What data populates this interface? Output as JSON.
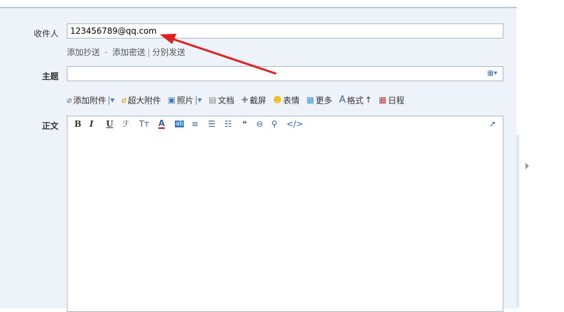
{
  "recipient": {
    "label": "收件人",
    "value": "123456789@qq.com"
  },
  "cc_links": {
    "cc": "添加抄送",
    "sep1": " - ",
    "bcc": "添加密送",
    "sep2": "|",
    "separate": "分别发送"
  },
  "subject": {
    "label": "主题",
    "value": ""
  },
  "attach_toolbar": [
    {
      "icon": "paperclip-icon",
      "label": "添加附件",
      "dropdown": "|▾"
    },
    {
      "icon": "large-attachment-icon",
      "label": "超大附件"
    },
    {
      "icon": "photo-icon",
      "label": "照片",
      "dropdown": "|▾"
    },
    {
      "icon": "document-icon",
      "label": "文档"
    },
    {
      "icon": "screenshot-icon",
      "label": "截屏"
    },
    {
      "icon": "emoji-icon",
      "label": "表情"
    },
    {
      "icon": "more-icon",
      "label": "更多"
    },
    {
      "icon": "format-icon",
      "label": "格式",
      "suffix": "↑"
    },
    {
      "icon": "calendar-icon",
      "label": "日程"
    }
  ],
  "body": {
    "label": "正文"
  },
  "editor_toolbar": {
    "bold": "B",
    "italic": "I",
    "underline": "U",
    "font": "ℱ",
    "size": "Tт",
    "color": "A",
    "bgcolor": "ab",
    "align": "≡",
    "list": "☰",
    "indent": "☷",
    "quote": "❝",
    "link": "⊖",
    "clear": "⚲",
    "html": "</>",
    "expand": "↗"
  },
  "colors": {
    "accent": "#e02020",
    "link": "#333333",
    "panel": "#eef3f9",
    "border": "#a9b8c8"
  }
}
